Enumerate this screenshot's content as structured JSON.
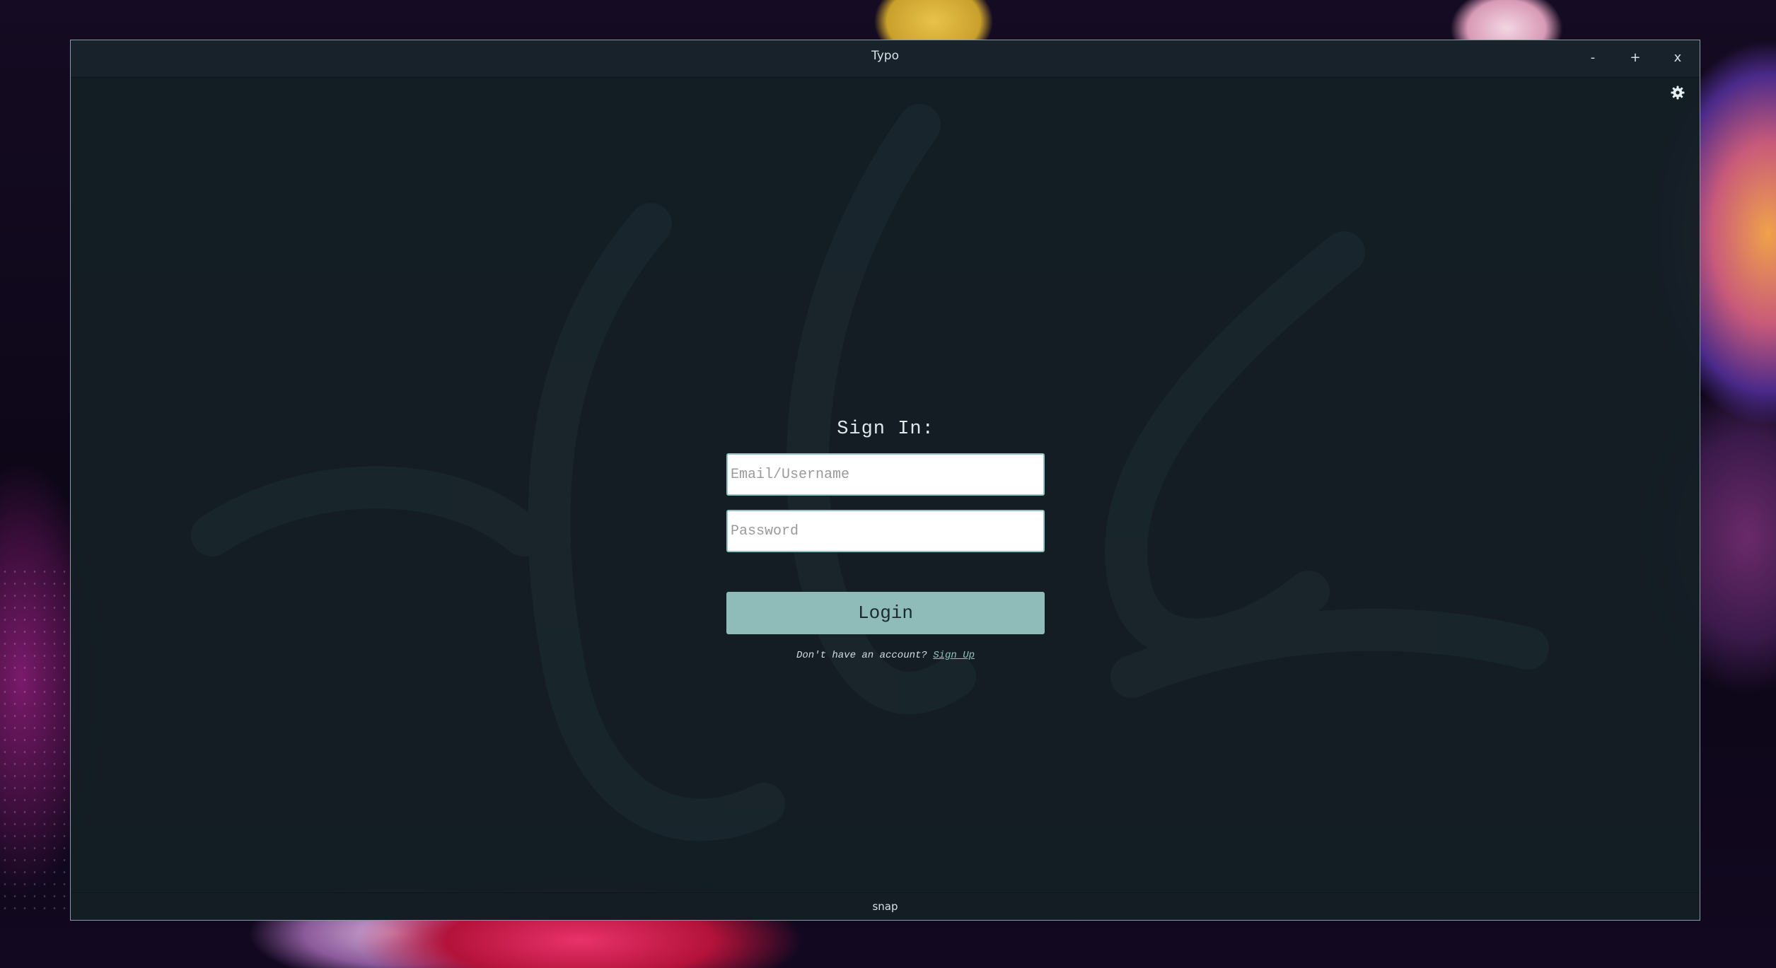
{
  "window": {
    "title": "Typo",
    "controls": {
      "minimize": "-",
      "maximize": "+",
      "close": "x"
    },
    "settings_icon": "gear-icon"
  },
  "signin": {
    "heading": "Sign In:",
    "email_placeholder": "Email/Username",
    "email_value": "",
    "password_placeholder": "Password",
    "password_value": "",
    "login_label": "Login",
    "signup_prompt": "Don't have an account?",
    "signup_link": "Sign Up"
  },
  "statusbar": {
    "text": "snap"
  },
  "colors": {
    "window_bg": "#141e24",
    "accent": "#8fc3c0",
    "button_bg": "#8fbcb8"
  }
}
